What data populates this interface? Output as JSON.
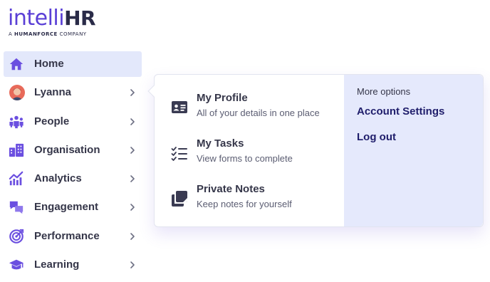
{
  "brand": {
    "logo_main": "intelli",
    "logo_accent": "HR",
    "logo_sub_prefix": "A ",
    "logo_sub_brand": "HUMANFORCE",
    "logo_sub_suffix": " COMPANY"
  },
  "sidebar": {
    "items": [
      {
        "label": "Home",
        "icon": "home-icon",
        "active": true,
        "has_chevron": false
      },
      {
        "label": "Lyanna",
        "icon": "avatar",
        "active": false,
        "has_chevron": true
      },
      {
        "label": "People",
        "icon": "people-icon",
        "active": false,
        "has_chevron": true
      },
      {
        "label": "Organisation",
        "icon": "organisation-icon",
        "active": false,
        "has_chevron": true
      },
      {
        "label": "Analytics",
        "icon": "analytics-icon",
        "active": false,
        "has_chevron": true
      },
      {
        "label": "Engagement",
        "icon": "engagement-icon",
        "active": false,
        "has_chevron": true
      },
      {
        "label": "Performance",
        "icon": "performance-icon",
        "active": false,
        "has_chevron": true
      },
      {
        "label": "Learning",
        "icon": "learning-icon",
        "active": false,
        "has_chevron": true
      }
    ]
  },
  "popover": {
    "items": [
      {
        "title": "My Profile",
        "description": "All of your details in one place",
        "icon": "id-card-icon"
      },
      {
        "title": "My Tasks",
        "description": "View forms to complete",
        "icon": "task-list-icon"
      },
      {
        "title": "Private Notes",
        "description": "Keep notes for yourself",
        "icon": "notes-icon"
      }
    ],
    "more_options_label": "More options",
    "links": [
      {
        "label": "Account Settings"
      },
      {
        "label": "Log out"
      }
    ]
  },
  "colors": {
    "brand_purple": "#5a3fd6",
    "icon_purple": "#6b4fe0",
    "text_dark": "#353649",
    "link_navy": "#1f1d6b",
    "active_bg": "#e3e8fb",
    "panel_bg": "#e5e9fc"
  }
}
